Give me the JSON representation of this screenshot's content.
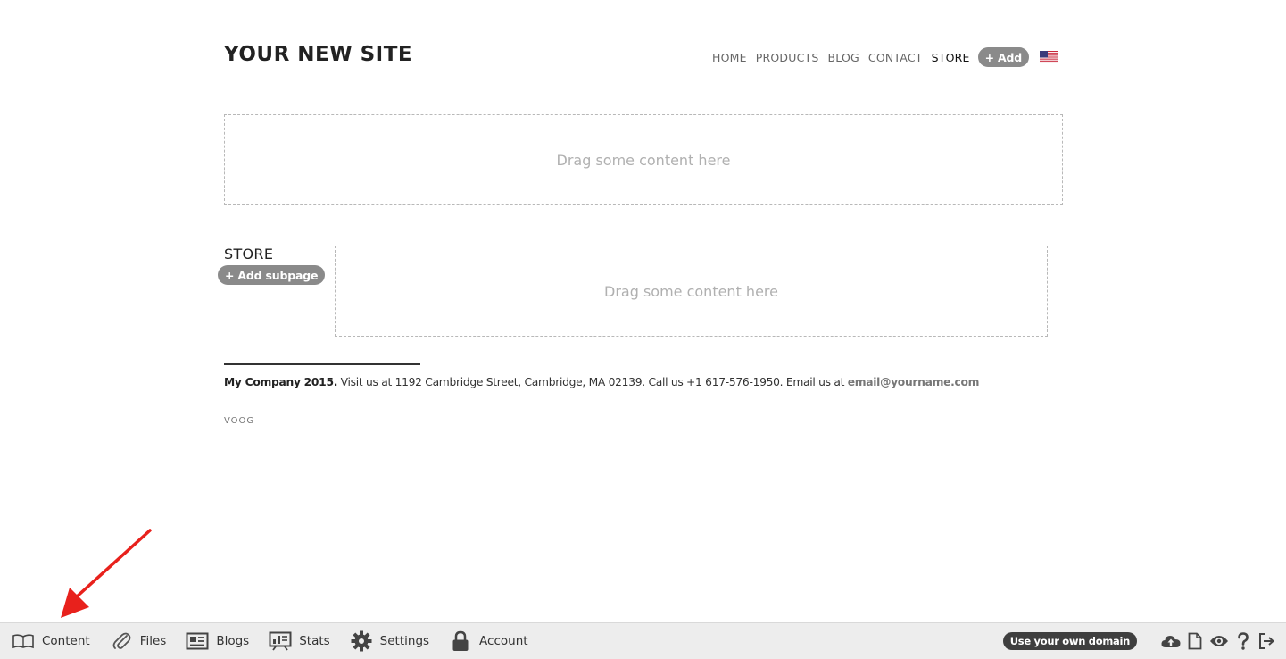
{
  "site": {
    "title": "YOUR NEW SITE"
  },
  "nav": {
    "items": [
      {
        "label": "HOME"
      },
      {
        "label": "PRODUCTS"
      },
      {
        "label": "BLOG"
      },
      {
        "label": "CONTACT"
      },
      {
        "label": "STORE",
        "active": true
      }
    ],
    "add_label": "+ Add",
    "language_icon": "us-flag-icon"
  },
  "dropzones": [
    {
      "text": "Drag some content here"
    },
    {
      "text": "Drag some content here"
    }
  ],
  "store": {
    "title": "STORE",
    "add_subpage_label": "+ Add subpage"
  },
  "footer": {
    "company": "My Company 2015.",
    "text": " Visit us at 1192 Cambridge Street, Cambridge, MA 02139. Call us +1 617-576-1950. Email us at ",
    "email": "email@yourname.com",
    "logo": "VOOG"
  },
  "toolbar": {
    "items": [
      {
        "label": "Content",
        "icon": "book-icon"
      },
      {
        "label": "Files",
        "icon": "paperclip-icon"
      },
      {
        "label": "Blogs",
        "icon": "newspaper-icon"
      },
      {
        "label": "Stats",
        "icon": "chart-icon"
      },
      {
        "label": "Settings",
        "icon": "gear-icon"
      },
      {
        "label": "Account",
        "icon": "lock-icon"
      }
    ],
    "domain_label": "Use your own domain",
    "right_icons": [
      "cloud-upload-icon",
      "page-icon",
      "eye-icon",
      "help-icon",
      "logout-icon"
    ]
  },
  "colors": {
    "annotation_arrow": "#e8211c",
    "pill_gray": "#8a8a8a",
    "toolbar_bg": "#ededed",
    "domain_pill": "#3f3f3f"
  }
}
